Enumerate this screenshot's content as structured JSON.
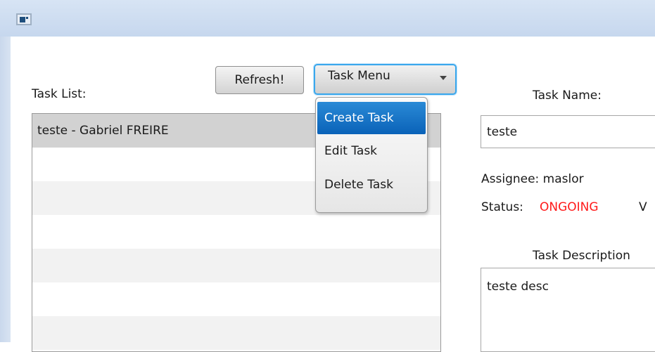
{
  "window": {
    "icon": "java-app-icon"
  },
  "toolbar": {
    "refresh_label": "Refresh!",
    "task_menu_label": "Task Menu"
  },
  "task_menu": {
    "items": [
      {
        "label": "Create Task",
        "active": true
      },
      {
        "label": "Edit Task",
        "active": false
      },
      {
        "label": "Delete Task",
        "active": false
      }
    ]
  },
  "task_list": {
    "label": "Task List:",
    "rows": [
      {
        "text": "teste -  Gabriel FREIRE",
        "selected": true
      },
      {
        "text": ""
      },
      {
        "text": ""
      },
      {
        "text": ""
      },
      {
        "text": ""
      },
      {
        "text": ""
      },
      {
        "text": ""
      }
    ]
  },
  "details": {
    "name_label": "Task Name:",
    "name_value": "teste",
    "assignee_text": "Assignee: maslor",
    "status_label": "Status:",
    "status_value": "ONGOING",
    "status_color": "#ff1a1a",
    "extra_label_partial": "V",
    "description_label": "Task Description",
    "description_value": "teste desc"
  },
  "colors": {
    "accent": "#0a62b8",
    "focus_ring": "#3aa7ec",
    "titlebar": "#c6d7ee"
  }
}
